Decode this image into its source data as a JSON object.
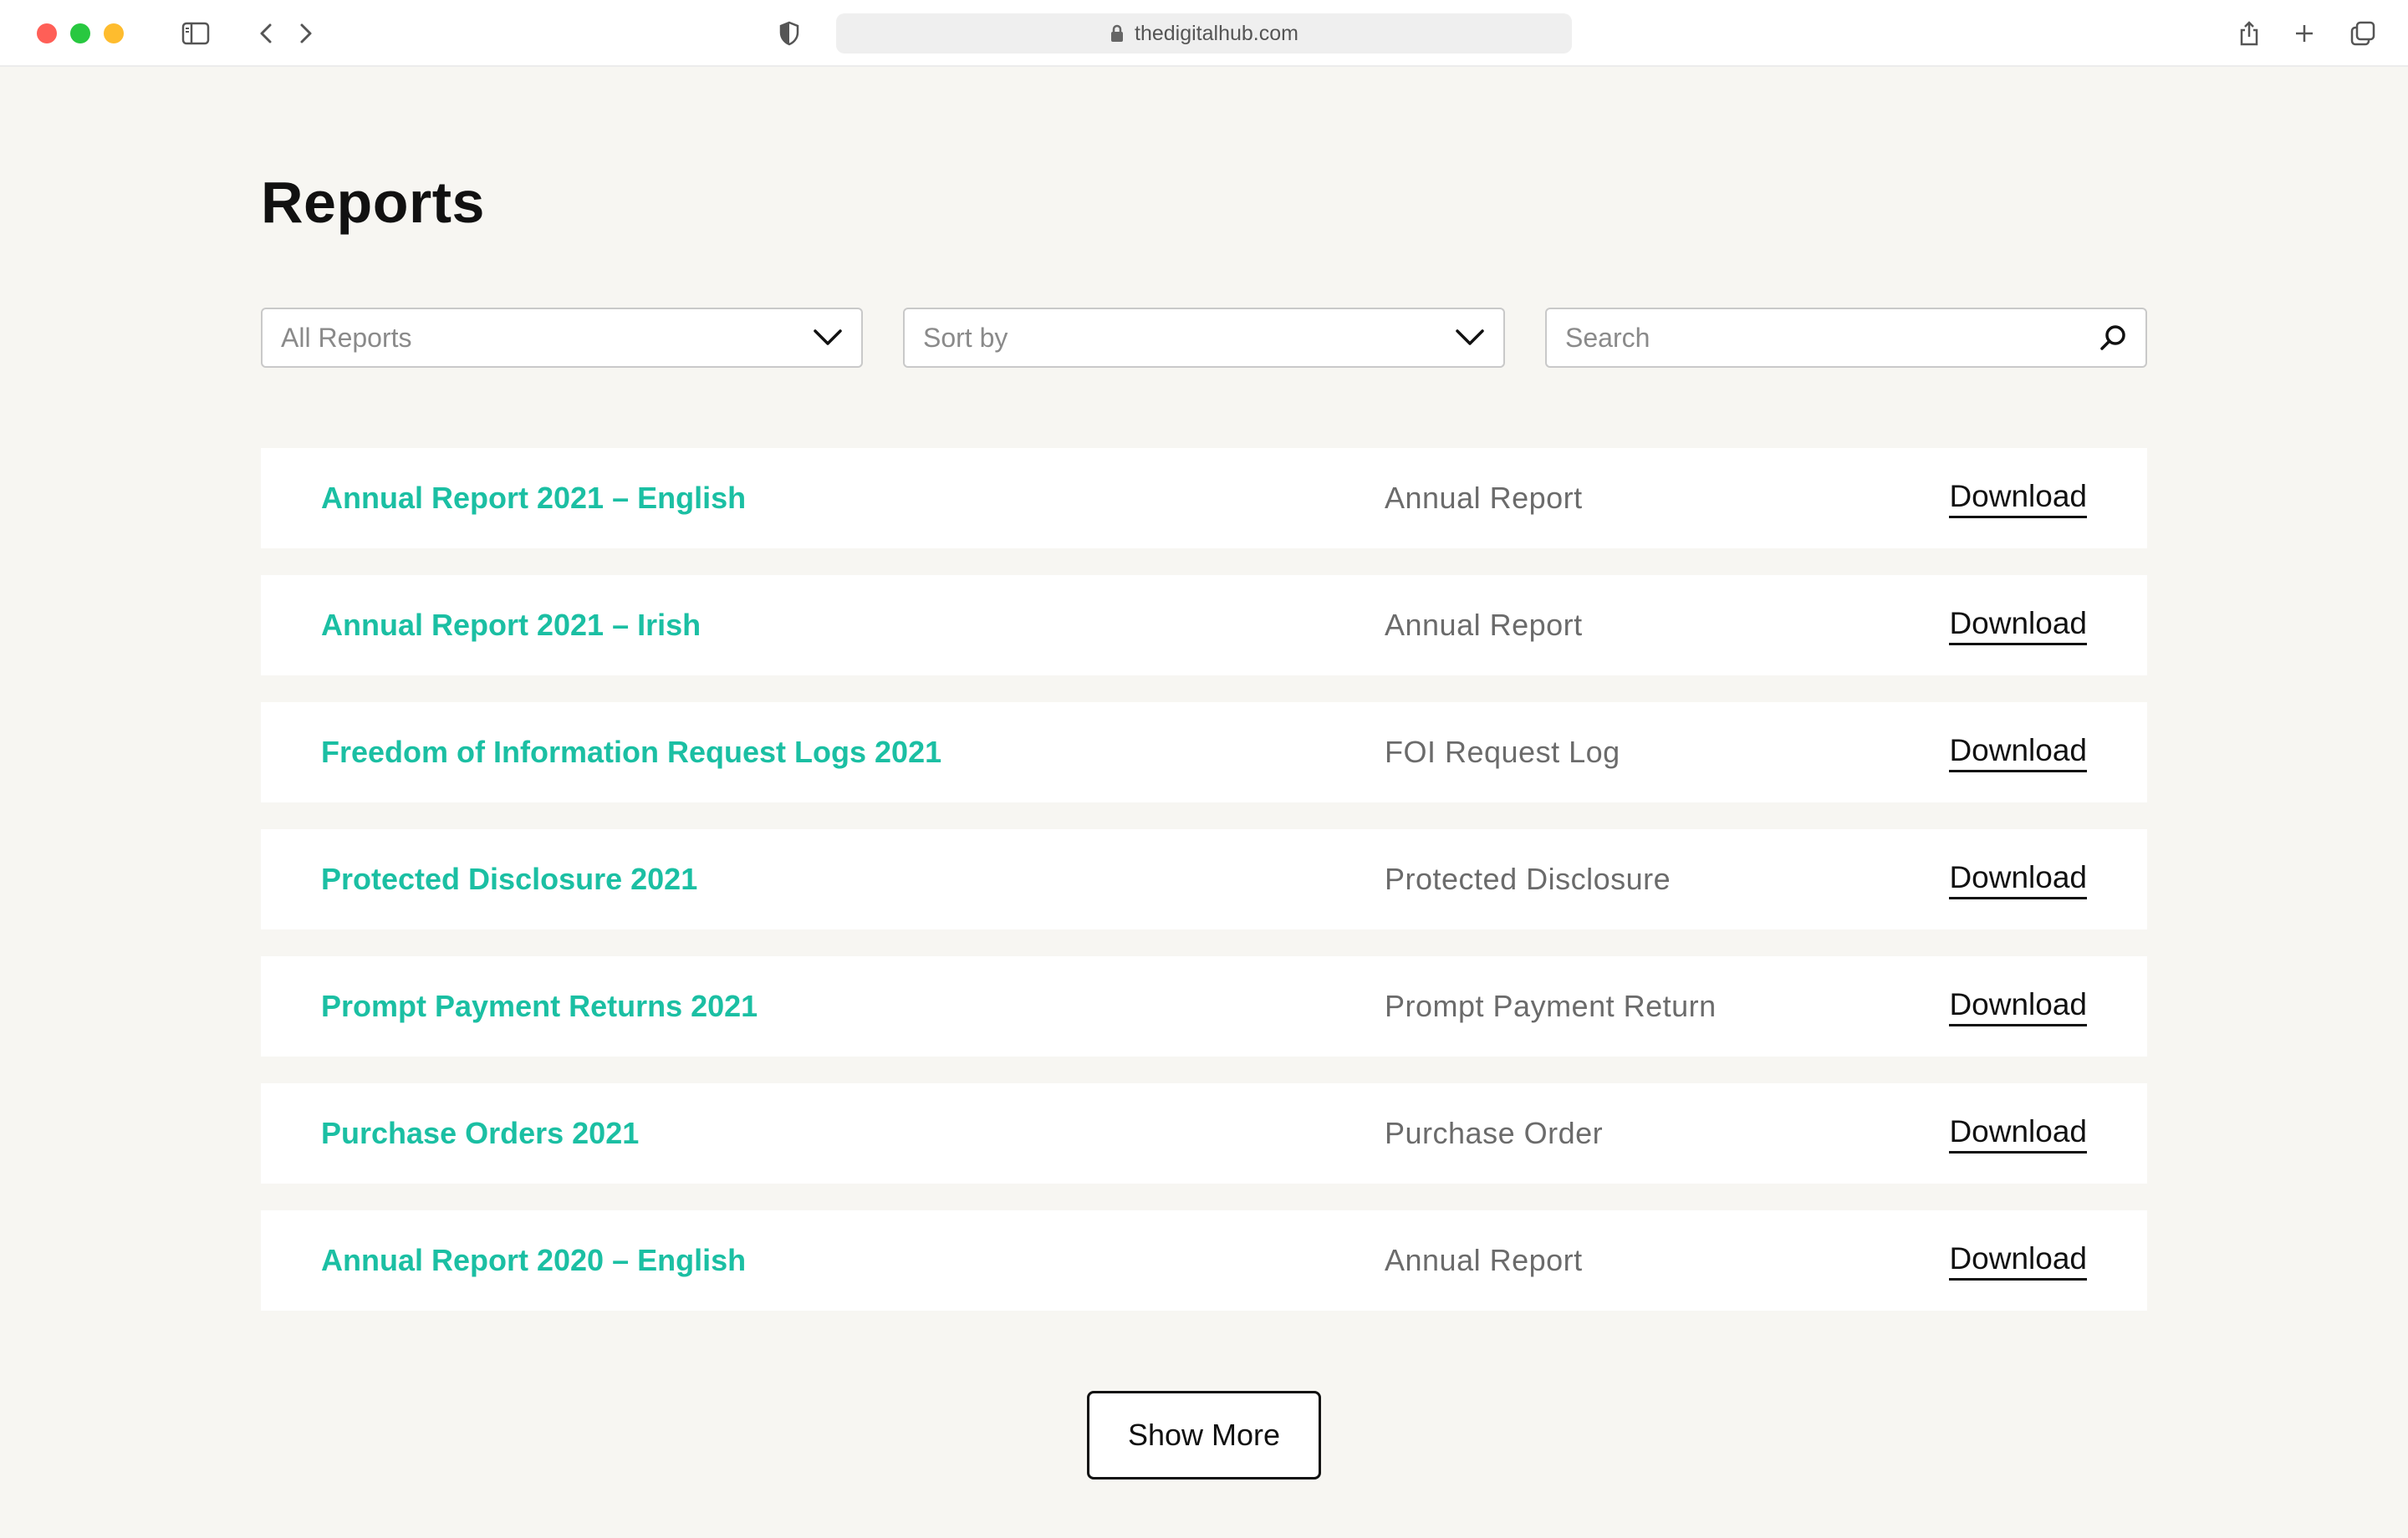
{
  "browser": {
    "url": "thedigitalhub.com"
  },
  "page": {
    "title": "Reports"
  },
  "filters": {
    "category_selected": "All Reports",
    "sort_selected": "Sort by",
    "search_placeholder": "Search"
  },
  "reports": [
    {
      "title": "Annual Report 2021 – English",
      "type": "Annual Report",
      "action": "Download"
    },
    {
      "title": "Annual Report 2021 – Irish",
      "type": "Annual Report",
      "action": "Download"
    },
    {
      "title": "Freedom of Information Request Logs 2021",
      "type": "FOI Request Log",
      "action": "Download"
    },
    {
      "title": "Protected Disclosure 2021",
      "type": "Protected Disclosure",
      "action": "Download"
    },
    {
      "title": "Prompt Payment Returns 2021",
      "type": "Prompt Payment Return",
      "action": "Download"
    },
    {
      "title": "Purchase Orders 2021",
      "type": "Purchase Order",
      "action": "Download"
    },
    {
      "title": "Annual Report 2020 – English",
      "type": "Annual Report",
      "action": "Download"
    }
  ],
  "show_more_label": "Show More",
  "colors": {
    "accent": "#1bbfa3",
    "background": "#f7f6f2",
    "text": "#111111"
  },
  "icons": {
    "sidebar": "sidebar-icon",
    "back": "chevron-left-icon",
    "forward": "chevron-right-icon",
    "privacy": "shield-icon",
    "lock": "lock-icon",
    "share": "share-icon",
    "new_tab": "plus-icon",
    "tabs": "tabs-overview-icon",
    "dropdown": "chevron-down-icon",
    "search": "search-icon"
  }
}
